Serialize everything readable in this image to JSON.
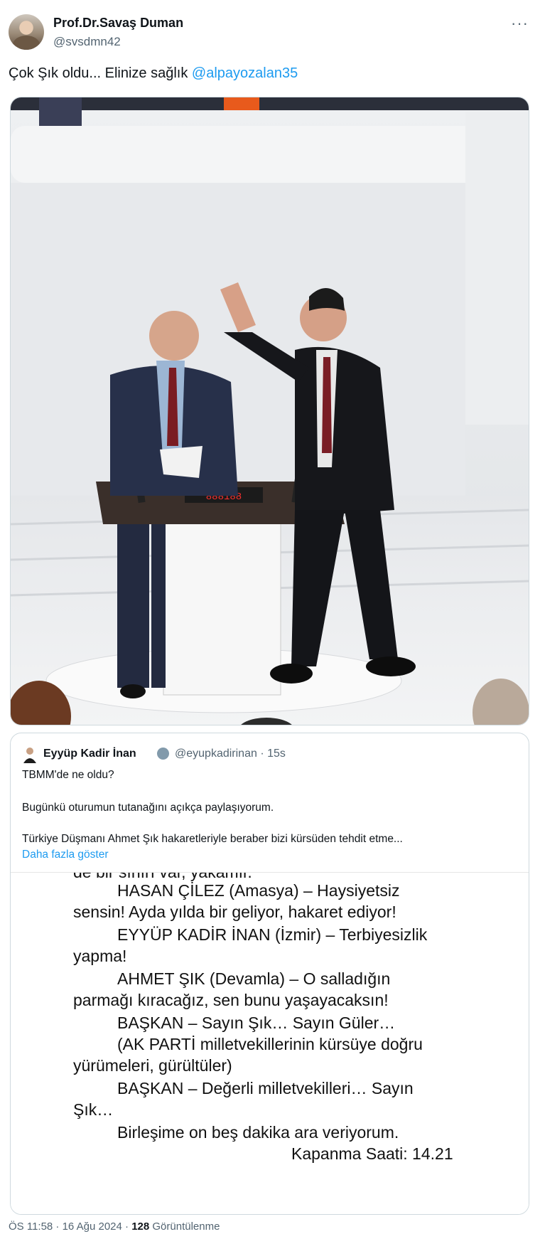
{
  "author": {
    "name": "Prof.Dr.Savaş Duman",
    "handle": "@svsdmn42"
  },
  "menu_icon": "more-horizontal-icon",
  "tweet": {
    "text": "Çok Şık oldu... Elinize sağlık ",
    "mention": "@alpayozalan35"
  },
  "media": {
    "description_icon": "photo",
    "podium_display": "888188"
  },
  "quoted_tweet": {
    "author_name": "Eyyüp Kadir İnan",
    "author_handle": "@eyupkadirinan",
    "time": "· 15s",
    "lines": [
      "TBMM'de ne oldu?",
      "Bugünkü oturumun tutanağını açıkça paylaşıyorum.",
      "Türkiye Düşmanı Ahmet Şık hakaretleriyle beraber bizi kürsüden tehdit etme..."
    ],
    "show_more": "Daha fazla göster"
  },
  "transcript": {
    "lines": [
      "de bir sınırı var, yakamır.",
      "HASAN ÇİLEZ (Amasya) – Haysiyetsiz",
      "sensin! Ayda yılda bir geliyor, hakaret ediyor!",
      "EYYÜP KADİR İNAN (İzmir) – Terbiyesizlik",
      "yapma!",
      "AHMET ŞIK (Devamla) – O salladığın",
      "parmağı kıracağız, sen bunu yaşayacaksın!",
      "BAŞKAN – Sayın Şık… Sayın Güler…",
      "(AK PARTİ milletvekillerinin kürsüye doğru",
      "yürümeleri, gürültüler)",
      "BAŞKAN – Değerli milletvekilleri… Sayın",
      "Şık…",
      "Birleşime on beş dakika ara veriyorum.",
      "Kapanma Saati: 14.21"
    ]
  },
  "footer": {
    "timestamp": "ÖS 11:58 · 16 Ağu 2024 · ",
    "views_count": "128",
    "views_label": " Görüntülenme"
  }
}
